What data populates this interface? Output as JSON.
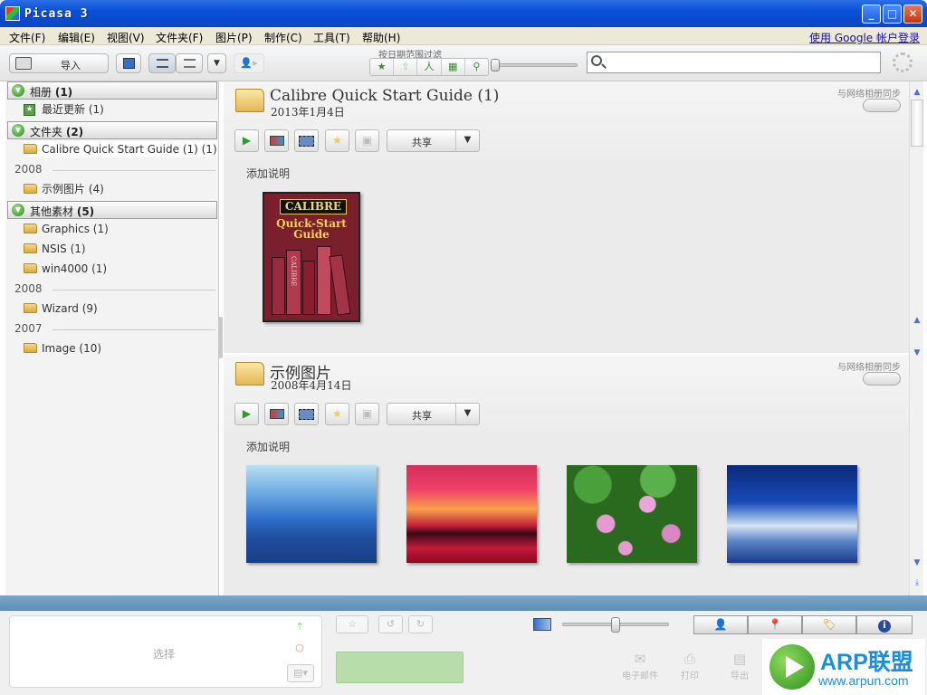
{
  "window": {
    "title": "Picasa 3"
  },
  "menu": {
    "items": [
      "文件(F)",
      "编辑(E)",
      "视图(V)",
      "文件夹(F)",
      "图片(P)",
      "制作(C)",
      "工具(T)",
      "帮助(H)"
    ],
    "login_link": "使用 Google 帐户登录"
  },
  "toolbar": {
    "import_label": "导入",
    "filter_label": "按日期范围过滤",
    "filter_icons": [
      "★",
      "⇧",
      "人",
      "▦",
      "⚲"
    ],
    "search": {
      "value": "",
      "placeholder": ""
    }
  },
  "sidebar": {
    "sections": [
      {
        "label": "相册",
        "count": "(1)"
      },
      {
        "label": "文件夹",
        "count": "(2)"
      },
      {
        "label": "其他素材",
        "count": "(5)"
      }
    ],
    "items": [
      {
        "label": "最近更新 (1)"
      },
      {
        "label": "Calibre Quick Start Guide (1) (1)"
      },
      {
        "label": "示例图片 (4)"
      },
      {
        "label": "Graphics (1)"
      },
      {
        "label": "NSIS (1)"
      },
      {
        "label": "win4000 (1)"
      },
      {
        "label": "Wizard (9)"
      },
      {
        "label": "Image (10)"
      }
    ],
    "years": [
      "2008",
      "2008",
      "2007"
    ]
  },
  "albums": [
    {
      "title": "Calibre Quick Start Guide (1)",
      "date": "2013年1月4日",
      "sync_label": "与网络相册同步",
      "share_label": "共享",
      "caption": "添加说明",
      "cover": {
        "heading": "CALIBRE",
        "sub1": "Quick-Start",
        "sub2": "Guide",
        "spine": "CALIBRE"
      }
    },
    {
      "title": "示例图片",
      "date": "2008年4月14日",
      "sync_label": "与网络相册同步",
      "share_label": "共享",
      "caption": "添加说明"
    }
  ],
  "bottom": {
    "tray_label": "选择",
    "action_labels": [
      "电子邮件",
      "打印",
      "导出"
    ],
    "watermark": {
      "brand": "ARP联盟",
      "url": "www.arpun.com"
    }
  },
  "colors": {
    "titlebar": "#0a4fd8",
    "accent_green": "#2b8a1a",
    "link": "#1a0dab",
    "watermark": "#1a8fd8"
  }
}
